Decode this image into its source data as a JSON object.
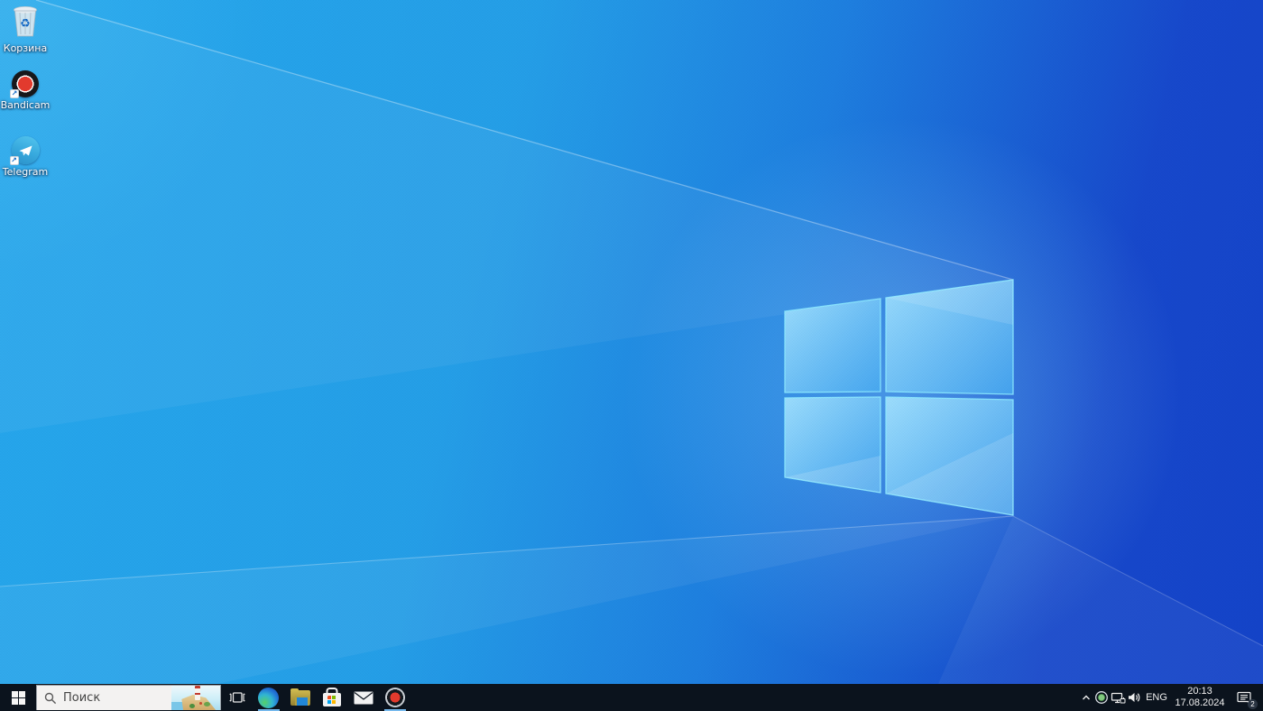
{
  "desktop": {
    "icons": [
      {
        "label": "Корзина"
      },
      {
        "label": "Bandicam"
      },
      {
        "label": "Telegram"
      }
    ]
  },
  "icons": {
    "recycle_glyph": "♻",
    "shortcut_arrow_glyph": "↗"
  },
  "taskbar": {
    "search": {
      "placeholder": "Поиск"
    },
    "running_apps": [
      "edge",
      "bandicam"
    ],
    "tray": {
      "language": "ENG",
      "time": "20:13",
      "date": "17.08.2024",
      "notification_badge": "2"
    }
  },
  "colors": {
    "taskbar_bg": "#0b131d",
    "running_underline": "#76b9ed",
    "wallpaper_left": "#26a8ec",
    "wallpaper_right": "#1443c8",
    "logo_stroke": "#8deaff",
    "search_box_bg": "#f3f2f1",
    "search_text": "#444444",
    "tray_text": "#f0f0f0",
    "telegram_blue": "#36a8dd",
    "bandicam_red": "#e23a2d",
    "recycle_blue": "#1368c4"
  }
}
